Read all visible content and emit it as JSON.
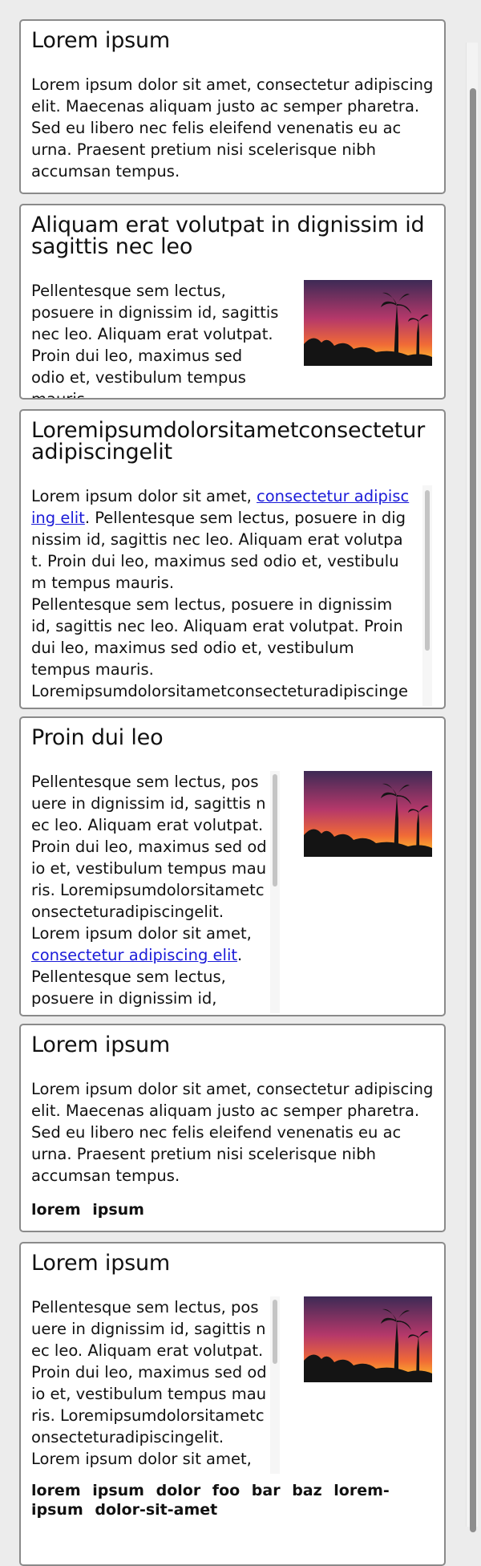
{
  "cards": [
    {
      "title": "Lorem ipsum",
      "text": "Lorem ipsum dolor sit amet, consectetur adipiscing elit. Maecenas aliquam justo ac semper pharetra. Sed eu libero nec felis eleifend venenatis eu ac urna. Praesent pretium nisi scelerisque nibh accumsan tempus."
    },
    {
      "title": "Aliquam erat volutpat in dignissim id sagittis nec leo",
      "text": "Pellentesque sem lectus, posuere in dignissim id, sagittis nec leo. Aliquam erat volutpat. Proin dui leo, maximus sed odio et, vestibulum tempus mauris."
    },
    {
      "title": "Loremipsumdolorsitametconsectetur adipiscingelit",
      "text_before_link": "Lorem ipsum dolor sit amet, ",
      "link": "consectetur adipiscing elit",
      "text_after_link": ". Pellentesque sem lectus, posuere in dignissim id, sagittis nec leo. Aliquam erat volutpat. Proin dui leo, maximus sed odio et, vestibulum tempus mauris.",
      "para2": "Pellentesque sem lectus, posuere in dignissim id, sagittis nec leo. Aliquam erat volutpat. Proin dui leo, maximus sed odio et, vestibulum tempus mauris.",
      "para3": "Loremipsumdolorsitametconsecteturadipiscingelitvestibulumtempusmaurisvestibulumtempusmauris"
    },
    {
      "title": "Proin dui leo",
      "para1": "Pellentesque sem lectus, posuere in dignissim id, sagittis nec leo. Aliquam erat volutpat. Proin dui leo, maximus sed odio et, vestibulum tempus mauris. Loremipsumdolorsitametconsecteturadipiscingelit.",
      "text_before_link": "Lorem ipsum dolor sit amet, ",
      "link": "consectetur adipiscing elit",
      "text_after_link": ".",
      "para3": "Pellentesque sem lectus, posuere in dignissim id, sagittis nec leo."
    },
    {
      "title": "Lorem ipsum",
      "text": "Lorem ipsum dolor sit amet, consectetur adipiscing elit. Maecenas aliquam justo ac semper pharetra. Sed eu libero nec felis eleifend venenatis eu ac urna. Praesent pretium nisi scelerisque nibh accumsan tempus.",
      "tags": "lorem ipsum"
    },
    {
      "title": "Lorem ipsum",
      "para1": "Pellentesque sem lectus, posuere in dignissim id, sagittis nec leo. Aliquam erat volutpat. Proin dui leo, maximus sed odio et, vestibulum tempus mauris. Loremipsumdolorsitametconsecteturadipiscingelit.",
      "para2": "Lorem ipsum dolor sit amet,",
      "tags": "lorem ipsum dolor foo bar baz lorem-ipsum dolor-sit-amet"
    }
  ],
  "colors": {
    "card_border": "#8a8a8a",
    "link": "#1b1bd8",
    "page_background": "#ececec"
  },
  "image_name": "sunset-palm-trees-image"
}
